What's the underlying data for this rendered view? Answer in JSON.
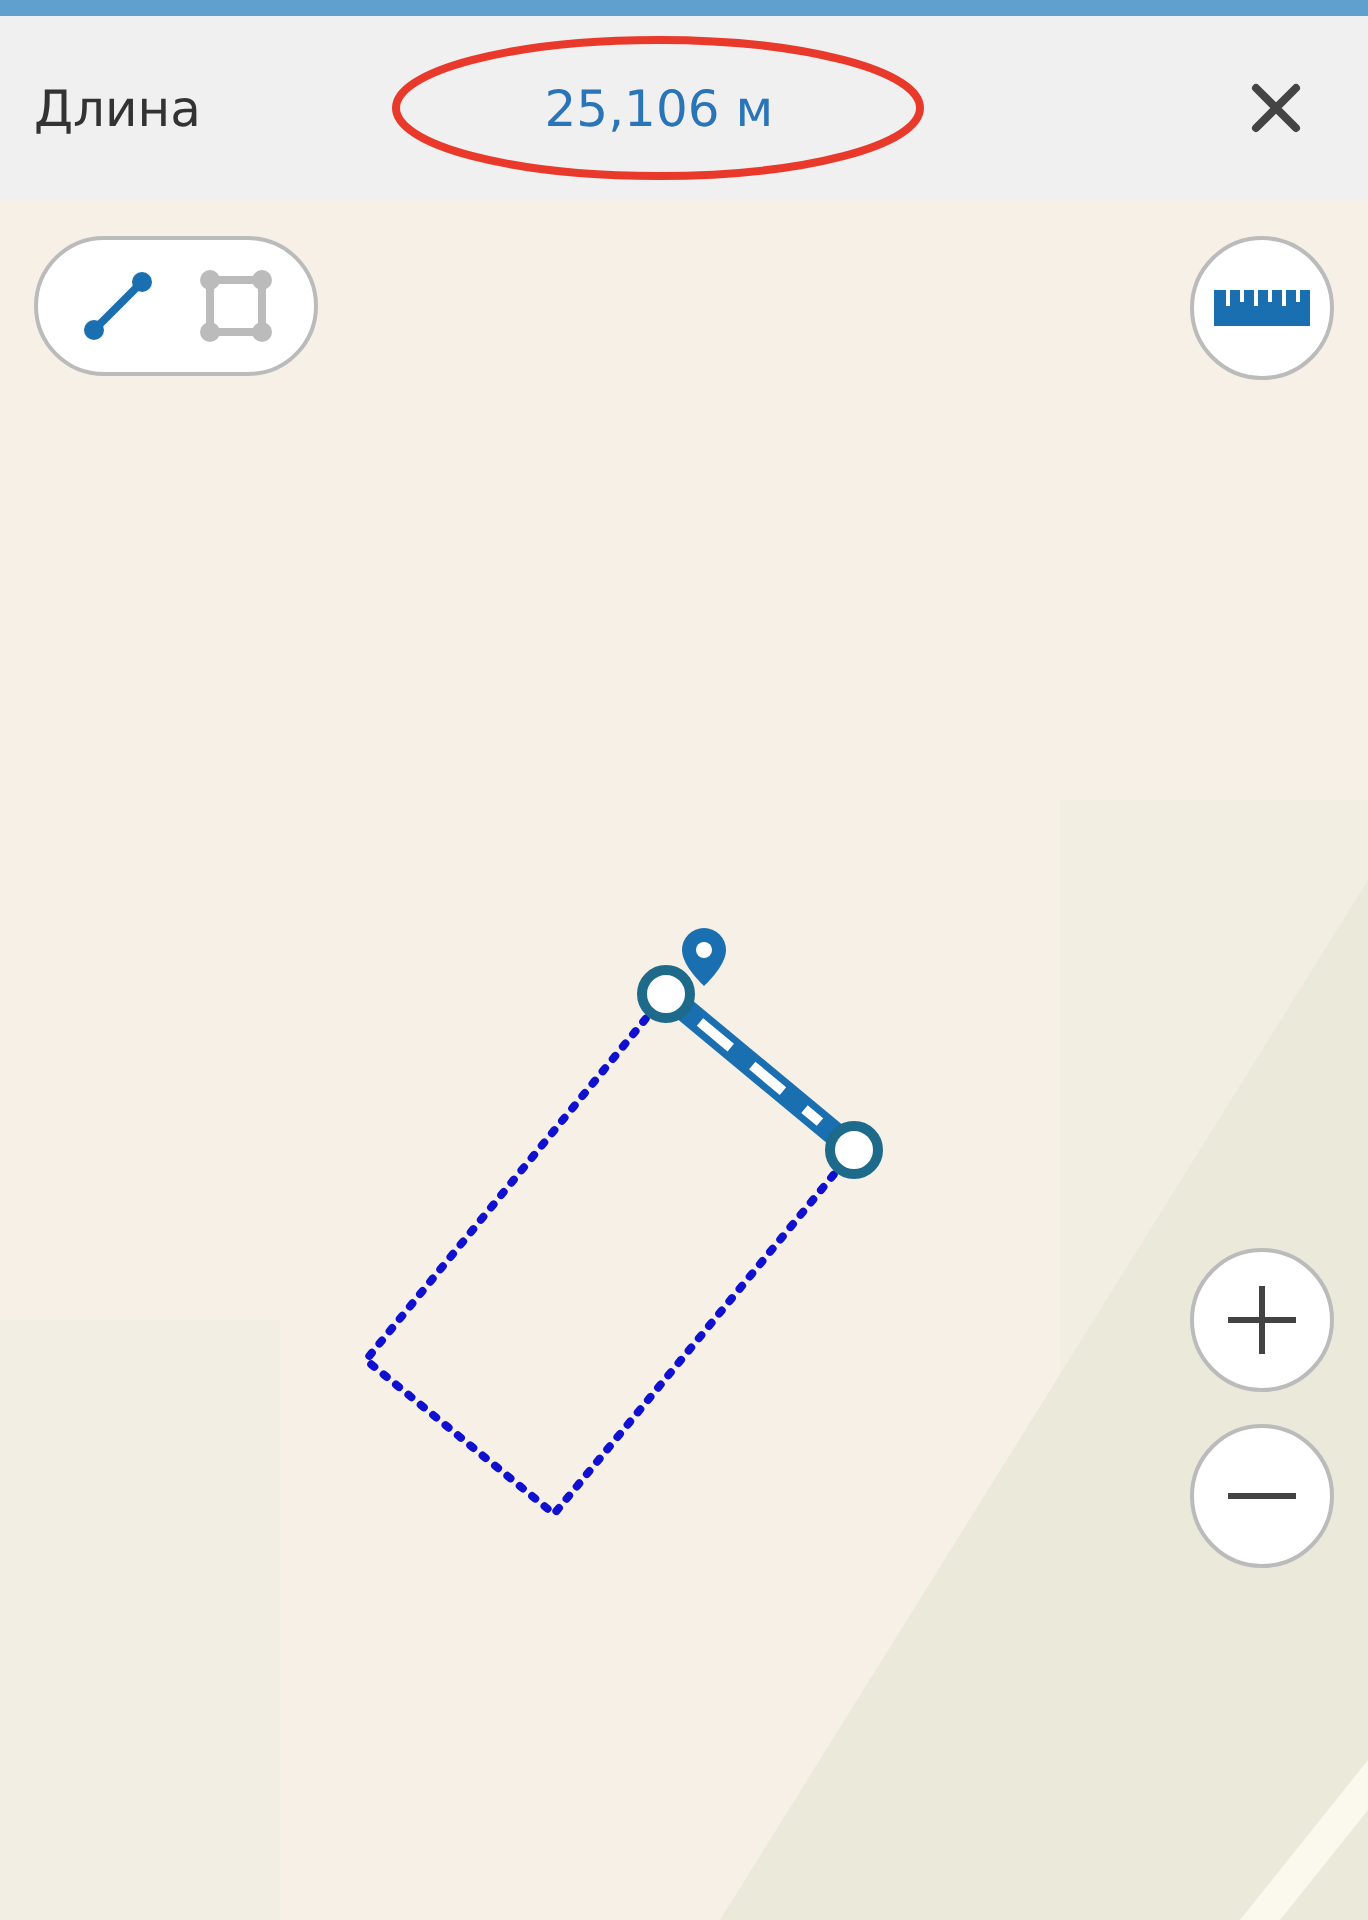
{
  "header": {
    "title": "Длина",
    "value": "25,106 м",
    "value_highlighted": true
  },
  "modes": [
    {
      "kind": "line",
      "selected": true
    },
    {
      "kind": "area",
      "selected": false
    }
  ]
}
